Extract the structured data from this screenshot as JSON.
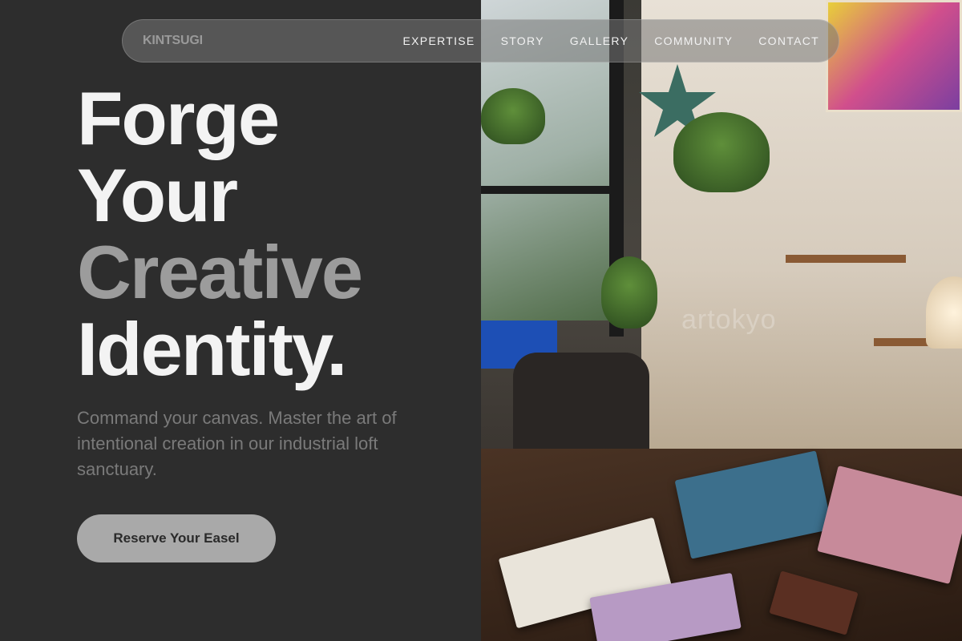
{
  "brand": {
    "logo": "KINTSUGI"
  },
  "nav": {
    "links": [
      "EXPERTISE",
      "STORY",
      "GALLERY",
      "COMMUNITY",
      "CONTACT"
    ]
  },
  "hero": {
    "line1": "Forge",
    "line2": "Your",
    "line3": "Creative",
    "line4": "Identity.",
    "subtitle": "Command your canvas. Master the art of intentional creation in our industrial loft sanctuary.",
    "cta_label": "Reserve Your Easel"
  },
  "image": {
    "watermark": "artokyo"
  },
  "colors": {
    "background": "#2d2d2d",
    "headline_white": "#f3f3f3",
    "headline_gray": "#9c9c9c",
    "cta_bg": "#a9a9a9"
  }
}
